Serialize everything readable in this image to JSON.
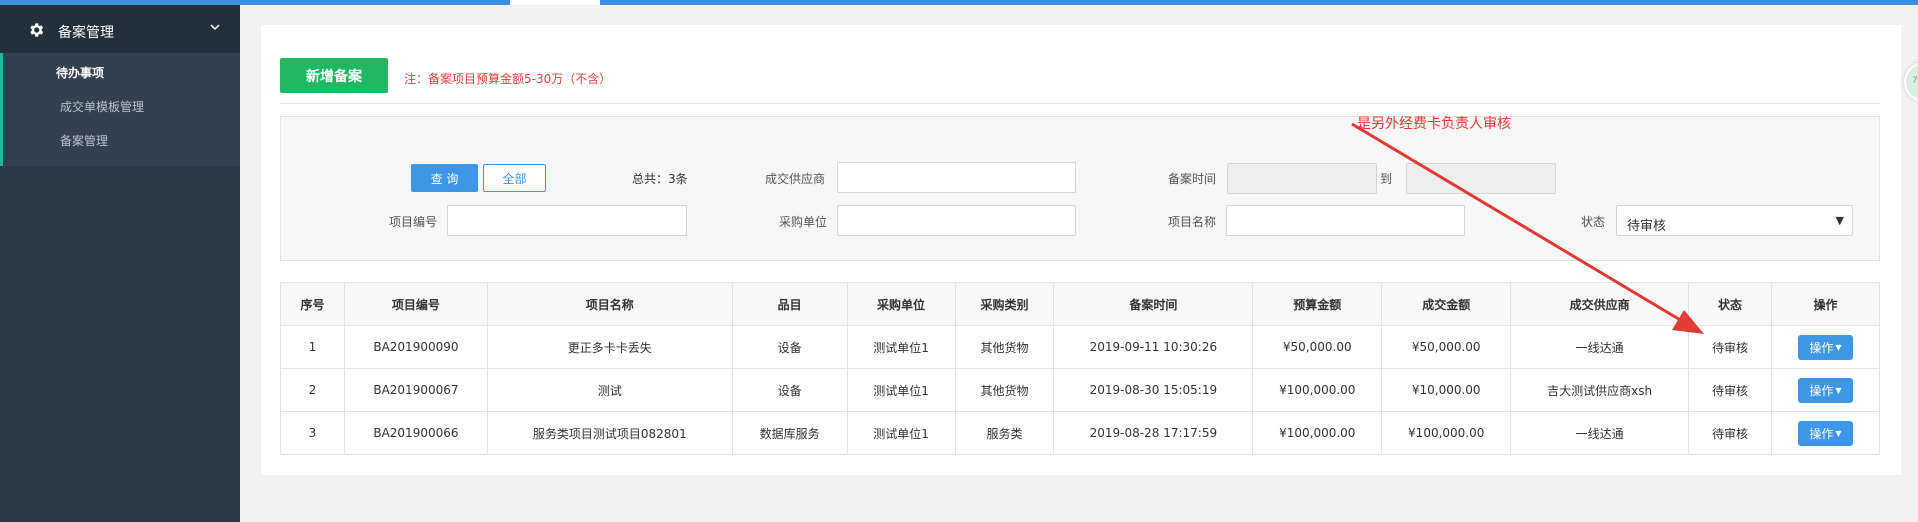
{
  "sidebar": {
    "title": "备案管理",
    "items": [
      {
        "label": "待办事项",
        "active": true
      },
      {
        "label": "成交单模板管理",
        "active": false
      },
      {
        "label": "备案管理",
        "active": false
      }
    ]
  },
  "toolbar": {
    "add_label": "新增备案",
    "note": "注：备案项目预算金额5-30万（不含）"
  },
  "search": {
    "query_label": "查 询",
    "all_label": "全部",
    "total_text": "总共：3条",
    "supplier_label": "成交供应商",
    "record_time_label": "备案时间",
    "to_label": "到",
    "project_no_label": "项目编号",
    "purchaser_label": "采购单位",
    "project_name_label": "项目名称",
    "status_label": "状态",
    "status_value": "待审核"
  },
  "table": {
    "columns": [
      "序号",
      "项目编号",
      "项目名称",
      "品目",
      "采购单位",
      "采购类别",
      "备案时间",
      "预算金额",
      "成交金额",
      "成交供应商",
      "状态",
      "操作"
    ],
    "rows": [
      {
        "no": "1",
        "code": "BA201900090",
        "name": "更正多卡卡丢失",
        "category": "设备",
        "purchaser": "测试单位1",
        "type": "其他货物",
        "time": "2019-09-11 10:30:26",
        "budget": "¥50,000.00",
        "deal": "¥50,000.00",
        "supplier": "一线达通",
        "status": "待审核",
        "action": "操作"
      },
      {
        "no": "2",
        "code": "BA201900067",
        "name": "测试",
        "category": "设备",
        "purchaser": "测试单位1",
        "type": "其他货物",
        "time": "2019-08-30 15:05:19",
        "budget": "¥100,000.00",
        "deal": "¥10,000.00",
        "supplier": "吉大测试供应商xsh",
        "status": "待审核",
        "action": "操作"
      },
      {
        "no": "3",
        "code": "BA201900066",
        "name": "服务类项目测试项目082801",
        "category": "数据库服务",
        "purchaser": "测试单位1",
        "type": "服务类",
        "time": "2019-08-28 17:17:59",
        "budget": "¥100,000.00",
        "deal": "¥100,000.00",
        "supplier": "一线达通",
        "status": "待审核",
        "action": "操作"
      }
    ]
  },
  "annotation": {
    "text": "是另外经费卡负责人审核",
    "color": "#e53935"
  },
  "colors": {
    "primary": "#3d96e6",
    "success": "#20b962",
    "sidebar": "#2b3a47",
    "danger": "#e04040"
  },
  "icons": [
    "gear-icon",
    "chevron-down-icon",
    "caret-down-icon"
  ]
}
